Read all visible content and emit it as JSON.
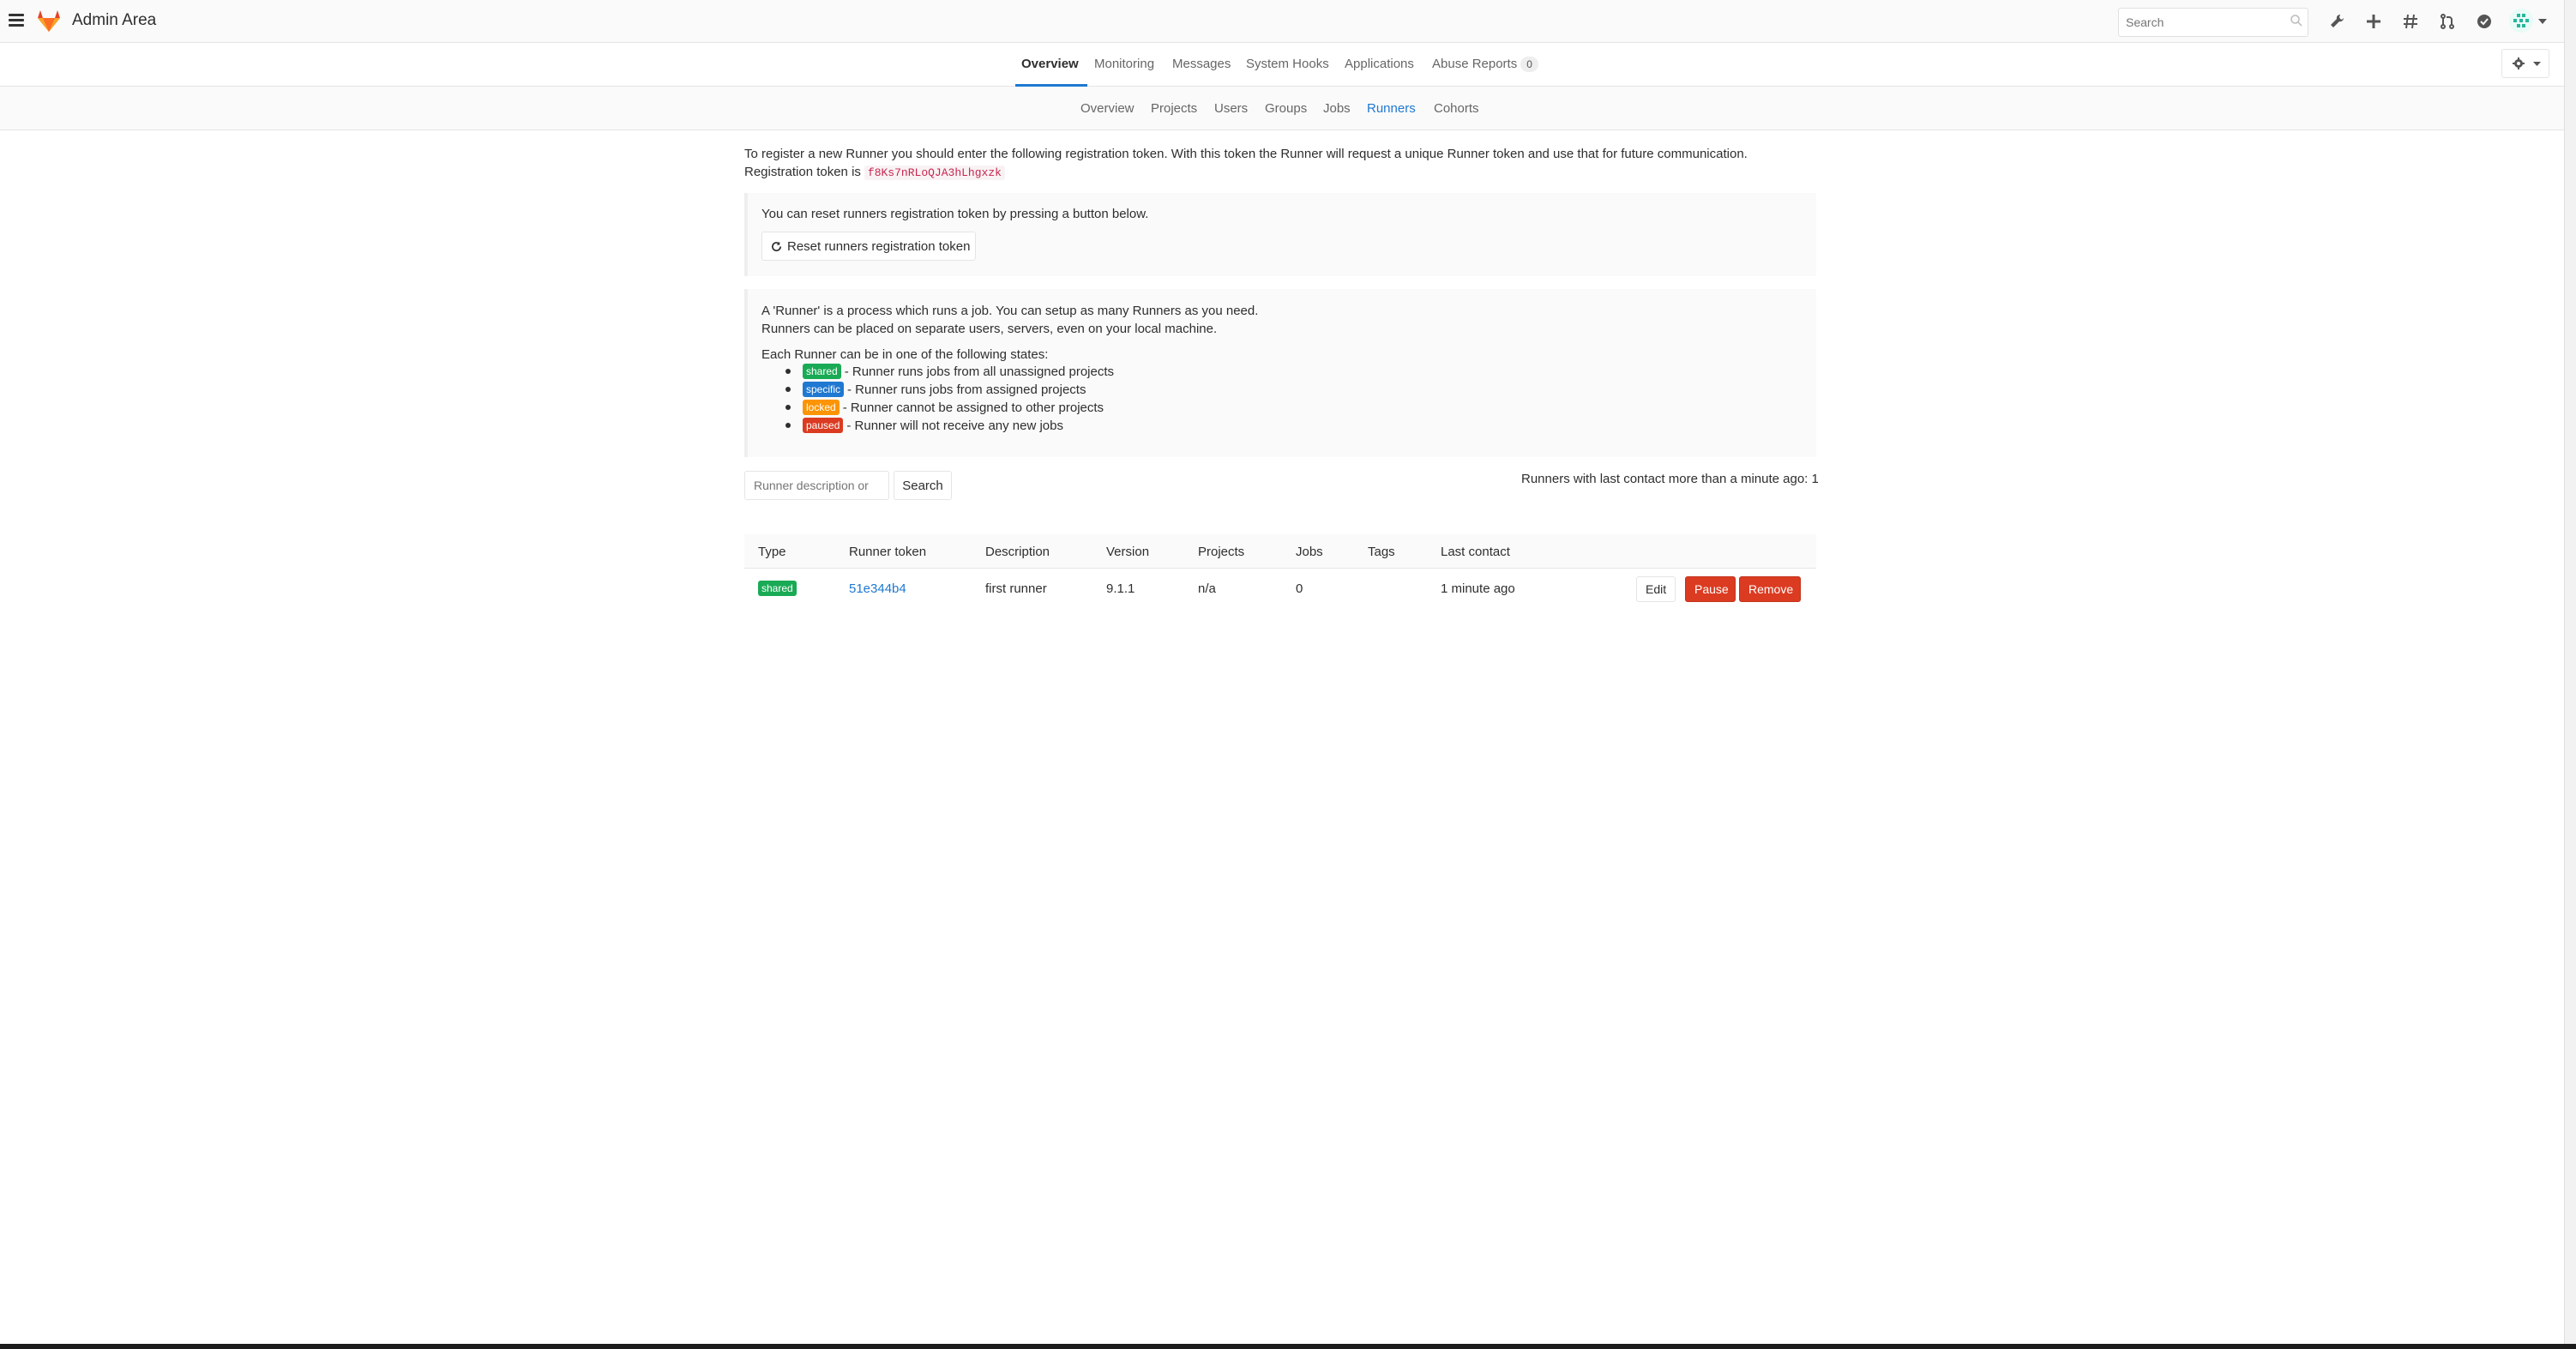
{
  "header": {
    "title": "Admin Area",
    "search_placeholder": "Search",
    "icons": [
      "admin-wrench-icon",
      "plus-icon",
      "issues-hash-icon",
      "merge-request-icon",
      "todo-check-icon",
      "user-avatar"
    ]
  },
  "top_nav": {
    "tabs": [
      {
        "label": "Overview",
        "active": true
      },
      {
        "label": "Monitoring"
      },
      {
        "label": "Messages"
      },
      {
        "label": "System Hooks"
      },
      {
        "label": "Applications"
      },
      {
        "label": "Abuse Reports",
        "count": "0"
      }
    ]
  },
  "sub_nav": {
    "items": [
      {
        "label": "Overview"
      },
      {
        "label": "Projects"
      },
      {
        "label": "Users"
      },
      {
        "label": "Groups"
      },
      {
        "label": "Jobs"
      },
      {
        "label": "Runners",
        "active": true
      },
      {
        "label": "Cohorts"
      }
    ]
  },
  "intro": {
    "line1": "To register a new Runner you should enter the following registration token. With this token the Runner will request a unique Runner token and use that for future communication.",
    "line2_prefix": "Registration token is",
    "token": "f8Ks7nRLoQJA3hLhgxzk"
  },
  "reset_well": {
    "text": "You can reset runners registration token by pressing a button below.",
    "button_label": "Reset runners registration token"
  },
  "info_well": {
    "p1": "A 'Runner' is a process which runs a job. You can setup as many Runners as you need.",
    "p2": "Runners can be placed on separate users, servers, even on your local machine.",
    "p3": "Each Runner can be in one of the following states:",
    "states": [
      {
        "label": "shared",
        "desc": "- Runner runs jobs from all unassigned projects"
      },
      {
        "label": "specific",
        "desc": "- Runner runs jobs from assigned projects"
      },
      {
        "label": "locked",
        "desc": "- Runner cannot be assigned to other projects"
      },
      {
        "label": "paused",
        "desc": "- Runner will not receive any new jobs"
      }
    ]
  },
  "filter": {
    "placeholder": "Runner description or",
    "search_label": "Search",
    "last_contact_note": "Runners with last contact more than a minute ago: 1"
  },
  "table": {
    "headers": [
      "Type",
      "Runner token",
      "Description",
      "Version",
      "Projects",
      "Jobs",
      "Tags",
      "Last contact"
    ],
    "rows": [
      {
        "type": "shared",
        "token": "51e344b4",
        "description": "first runner",
        "version": "9.1.1",
        "projects": "n/a",
        "jobs": "0",
        "tags": "",
        "last_contact": "1 minute ago",
        "edit_label": "Edit",
        "pause_label": "Pause",
        "remove_label": "Remove"
      }
    ]
  },
  "colors": {
    "accent": "#1f78d1",
    "shared": "#1aaa55",
    "specific": "#1f78d1",
    "locked": "#fc9403",
    "paused": "#db3b21"
  }
}
